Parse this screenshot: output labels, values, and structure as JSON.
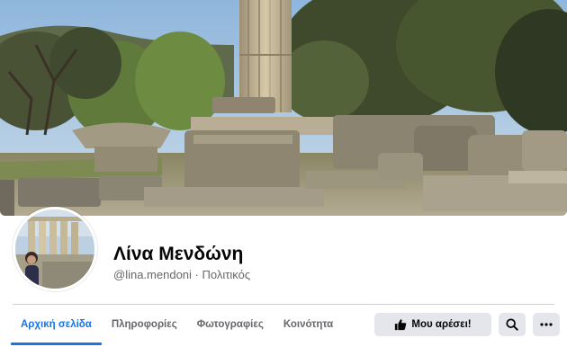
{
  "profile": {
    "name": "Λίνα Μενδώνη",
    "handle": "@lina.mendoni",
    "separator": "·",
    "category": "Πολιτικός"
  },
  "tabs": [
    {
      "label": "Αρχική σελίδα",
      "active": true
    },
    {
      "label": "Πληροφορίες",
      "active": false
    },
    {
      "label": "Φωτογραφίες",
      "active": false
    },
    {
      "label": "Κοινότητα",
      "active": false
    }
  ],
  "actions": {
    "like_label": "Μου αρέσει!",
    "like_icon": "thumbs-up-icon",
    "search_icon": "search-icon",
    "more_icon": "more-dots-icon"
  },
  "colors": {
    "accent": "#1b74e4",
    "button_bg": "#e4e6eb",
    "muted_text": "#65676b"
  }
}
